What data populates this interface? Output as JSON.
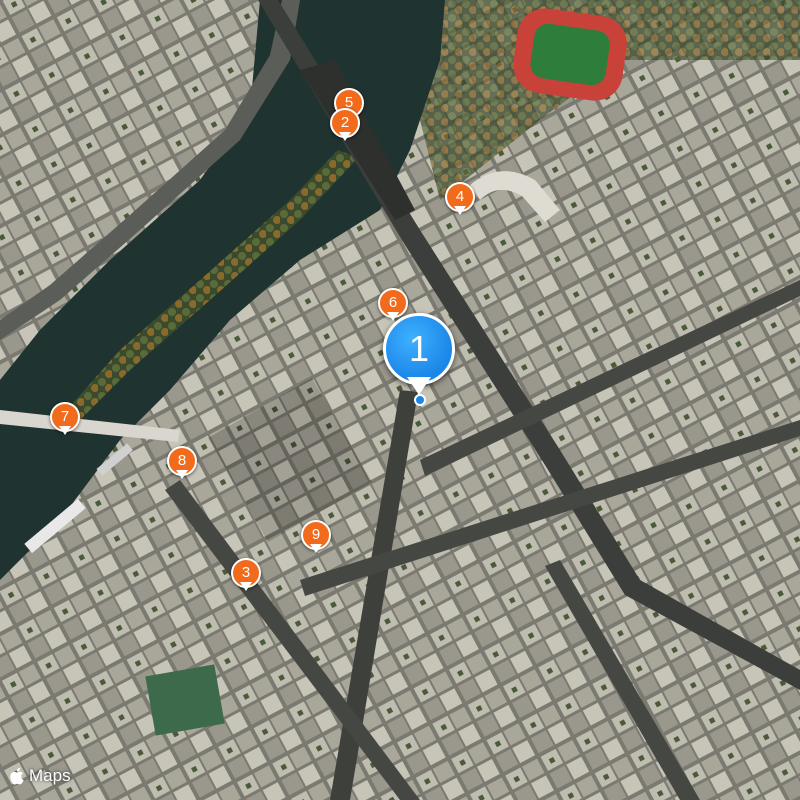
{
  "map": {
    "style": "satellite",
    "colors": {
      "water": "#1f3330",
      "marker": "#f26b1d",
      "main_marker": "#1a86e8",
      "track": "#c8423a",
      "field": "#2f7d3a"
    }
  },
  "markers": [
    {
      "label": "5",
      "icon": "map-pin-icon"
    },
    {
      "label": "2",
      "icon": "map-pin-icon"
    },
    {
      "label": "4",
      "icon": "map-pin-icon"
    },
    {
      "label": "6",
      "icon": "map-pin-icon"
    },
    {
      "label": "7",
      "icon": "map-pin-icon"
    },
    {
      "label": "8",
      "icon": "map-pin-icon"
    },
    {
      "label": "9",
      "icon": "map-pin-icon"
    },
    {
      "label": "3",
      "icon": "map-pin-icon"
    }
  ],
  "main_marker": {
    "label": "1",
    "icon": "map-pin-icon"
  },
  "attribution": {
    "text": "Maps",
    "icon": "apple-logo-icon"
  }
}
